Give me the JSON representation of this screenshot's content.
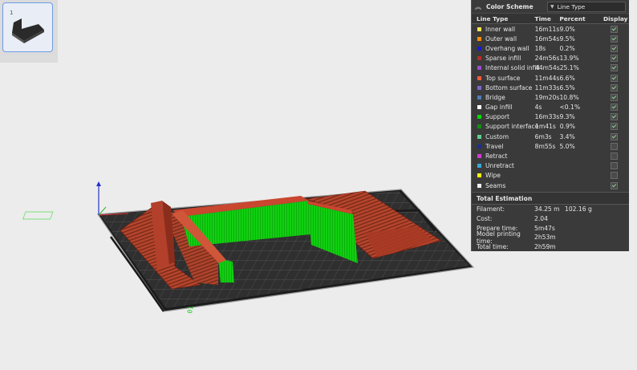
{
  "thumbnail": {
    "plate_number": "1"
  },
  "legend": {
    "header": {
      "title": "Color Scheme",
      "selected": "Line Type"
    },
    "columns": {
      "type": "Line Type",
      "time": "Time",
      "percent": "Percent",
      "display": "Display"
    },
    "rows": [
      {
        "name": "Inner wall",
        "time": "16m11s",
        "percent": "9.0%",
        "color": "#ffe64d",
        "display": true
      },
      {
        "name": "Outer wall",
        "time": "16m54s",
        "percent": "9.5%",
        "color": "#ff8c00",
        "display": true
      },
      {
        "name": "Overhang wall",
        "time": "18s",
        "percent": "0.2%",
        "color": "#1a1ad1",
        "display": true
      },
      {
        "name": "Sparse infill",
        "time": "24m56s",
        "percent": "13.9%",
        "color": "#b03029",
        "display": true
      },
      {
        "name": "Internal solid infill",
        "time": "44m54s",
        "percent": "25.1%",
        "color": "#9c4ccf",
        "display": true
      },
      {
        "name": "Top surface",
        "time": "11m44s",
        "percent": "6.6%",
        "color": "#ff5a3c",
        "display": true
      },
      {
        "name": "Bottom surface",
        "time": "11m33s",
        "percent": "6.5%",
        "color": "#7b68c9",
        "display": true
      },
      {
        "name": "Bridge",
        "time": "19m20s",
        "percent": "10.8%",
        "color": "#4c7eb5",
        "display": true
      },
      {
        "name": "Gap infill",
        "time": "4s",
        "percent": "<0.1%",
        "color": "#ffffff",
        "display": true
      },
      {
        "name": "Support",
        "time": "16m33s",
        "percent": "9.3%",
        "color": "#00d900",
        "display": true
      },
      {
        "name": "Support interface",
        "time": "1m41s",
        "percent": "0.9%",
        "color": "#128c12",
        "display": true
      },
      {
        "name": "Custom",
        "time": "6m3s",
        "percent": "3.4%",
        "color": "#5fcf8f",
        "display": true
      },
      {
        "name": "Travel",
        "time": "8m55s",
        "percent": "5.0%",
        "color": "#1e2f8a",
        "display": false
      },
      {
        "name": "Retract",
        "time": "",
        "percent": "",
        "color": "#d13cd1",
        "display": false
      },
      {
        "name": "Unretract",
        "time": "",
        "percent": "",
        "color": "#36a9d6",
        "display": false
      },
      {
        "name": "Wipe",
        "time": "",
        "percent": "",
        "color": "#ffff00",
        "display": false
      },
      {
        "name": "Seams",
        "time": "",
        "percent": "",
        "color": "#f0f0f0",
        "display": true
      }
    ]
  },
  "estimation": {
    "title": "Total Estimation",
    "rows": [
      {
        "label": "Filament:",
        "value": "34.25 m",
        "extra": "102.16 g"
      },
      {
        "label": "Cost:",
        "value": "2.04",
        "extra": ""
      },
      {
        "label": "Prepare time:",
        "value": "5m47s",
        "extra": ""
      },
      {
        "label": "Model printing time:",
        "value": "2h53m",
        "extra": ""
      },
      {
        "label": "Total time:",
        "value": "2h59m",
        "extra": ""
      }
    ]
  },
  "plate_label": "01"
}
